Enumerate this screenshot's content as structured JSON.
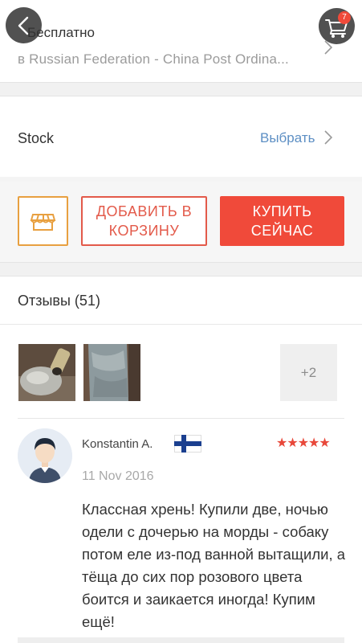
{
  "shipping": {
    "title": "Бесплатно",
    "method": "в Russian Federation - China Post Ordina..."
  },
  "stock": {
    "label": "Stock",
    "choose_label": "Выбрать"
  },
  "actions": {
    "add_to_cart_label": "ДОБАВИТЬ В КОРЗИНУ",
    "buy_now_label": "КУПИТЬ СЕЙЧАС"
  },
  "reviews": {
    "title": "Отзывы (51)",
    "more_photos": "+2",
    "items": [
      {
        "author": "Konstantin A.",
        "country_flag": "finland-flag",
        "rating": 5,
        "stars": "★★★★★",
        "date": "11 Nov 2016",
        "text": "Классная хрень! Купили две, ночью одели с дочерью на морды - собаку потом еле из-под ванной вытащили, а тёща до сих пор розового цвета боится и заикается иногда! Купим ещё!"
      }
    ]
  },
  "header": {
    "cart_count": "7"
  },
  "colors": {
    "accent_red": "#f04a3a",
    "store_orange": "#e8a040",
    "link_blue": "#5d8fc4",
    "star_red": "#e8483a"
  }
}
